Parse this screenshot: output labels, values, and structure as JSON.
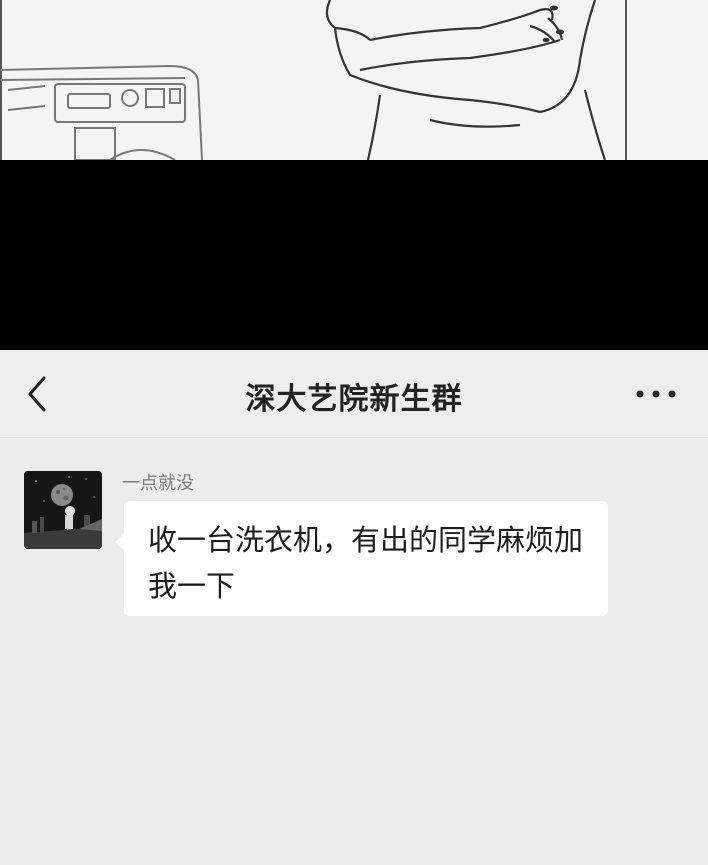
{
  "chat": {
    "title": "深大艺院新生群"
  },
  "icons": {
    "back": "chevron-left-icon",
    "more": "more-dots-icon"
  },
  "message": {
    "sender": "一点就没",
    "text": "收一台洗衣机，有出的同学麻烦加我一下"
  }
}
